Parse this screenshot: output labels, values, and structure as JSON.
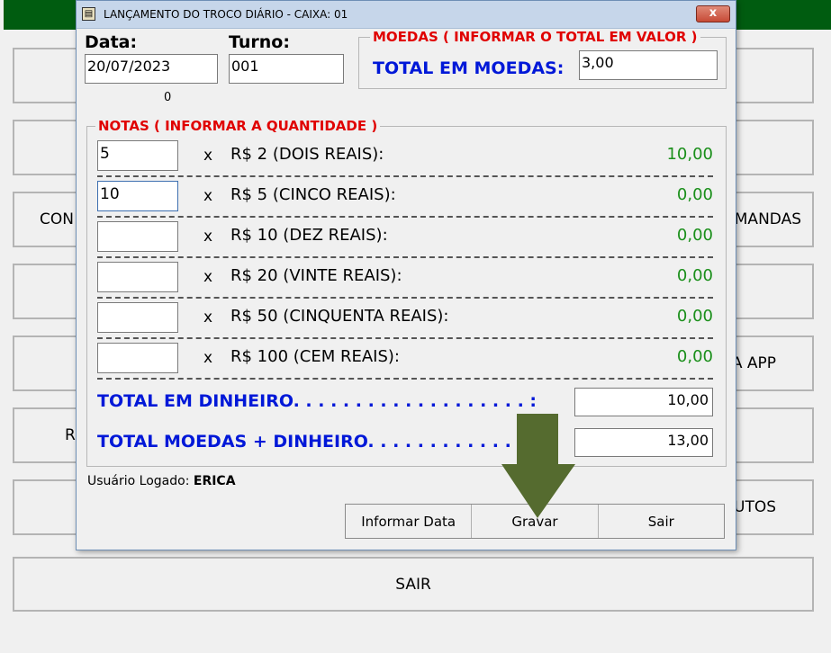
{
  "background_app": {
    "buttons": [
      {
        "label": "CON"
      },
      {
        "label": "MANDAS"
      },
      {
        "label": "A APP"
      },
      {
        "label": "R"
      },
      {
        "label": "UTOS"
      },
      {
        "label": "SAIR"
      }
    ]
  },
  "dialog": {
    "title": "LANÇAMENTO DO TROCO DIÁRIO - CAIXA: 01",
    "close_label": "x",
    "data_label": "Data:",
    "data_value": "20/07/2023",
    "turno_label": "Turno:",
    "turno_value": "001",
    "small_counter": "0",
    "moedas_group_title": "MOEDAS ( INFORMAR O TOTAL EM VALOR )",
    "total_moedas_label": "TOTAL EM MOEDAS:",
    "total_moedas_value": "3,00",
    "notas_group_title": "NOTAS ( INFORMAR A QUANTIDADE )",
    "notes": [
      {
        "qty": "5",
        "x": "x",
        "desc": "R$ 2 (DOIS REAIS):",
        "value": "10,00"
      },
      {
        "qty": "10",
        "x": "x",
        "desc": "R$ 5 (CINCO REAIS):",
        "value": "0,00"
      },
      {
        "qty": "",
        "x": "x",
        "desc": "R$ 10 (DEZ REAIS):",
        "value": "0,00"
      },
      {
        "qty": "",
        "x": "x",
        "desc": "R$ 20 (VINTE REAIS):",
        "value": "0,00"
      },
      {
        "qty": "",
        "x": "x",
        "desc": "R$ 50 (CINQUENTA REAIS):",
        "value": "0,00"
      },
      {
        "qty": "",
        "x": "x",
        "desc": "R$ 100 (CEM REAIS):",
        "value": "0,00"
      }
    ],
    "total_dinheiro_label": "TOTAL EM DINHEIRO. . . . . . . . . . . . . . . . . . . :",
    "total_dinheiro_value": "10,00",
    "total_geral_label": "TOTAL MOEDAS + DINHEIRO. . . . . . . . . . . . :",
    "total_geral_value": "13,00",
    "user_label": "Usuário Logado:",
    "user_name": "ERICA",
    "buttons": {
      "informar_data": "Informar Data",
      "gravar": "Gravar",
      "sair": "Sair"
    }
  },
  "colors": {
    "header_bar": "#005c10",
    "group_title_red": "#e00000",
    "total_blue": "#0018d8",
    "value_green": "#1a8f1a",
    "arrow_olive": "#556b2f"
  },
  "icons": [
    "app-icon",
    "close-icon",
    "down-arrow-icon"
  ]
}
